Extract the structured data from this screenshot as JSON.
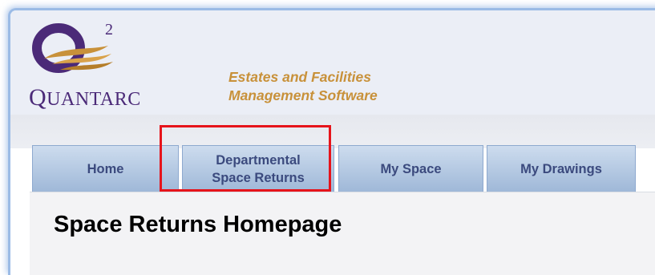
{
  "logo": {
    "superscript": "2",
    "name_first": "Q",
    "name_rest": "UANTARC",
    "tagline_line1": "Estates and Facilities",
    "tagline_line2": "Management Software"
  },
  "tabs": [
    {
      "label": "Home"
    },
    {
      "label_line1": "Departmental",
      "label_line2": "Space Returns"
    },
    {
      "label": "My Space"
    },
    {
      "label": "My Drawings"
    }
  ],
  "main": {
    "page_title": "Space Returns Homepage"
  },
  "colors": {
    "logo_purple": "#4b2a78",
    "tagline_gold": "#c8913a",
    "tab_text": "#3b4a7e",
    "highlight_red": "#e6141b"
  }
}
